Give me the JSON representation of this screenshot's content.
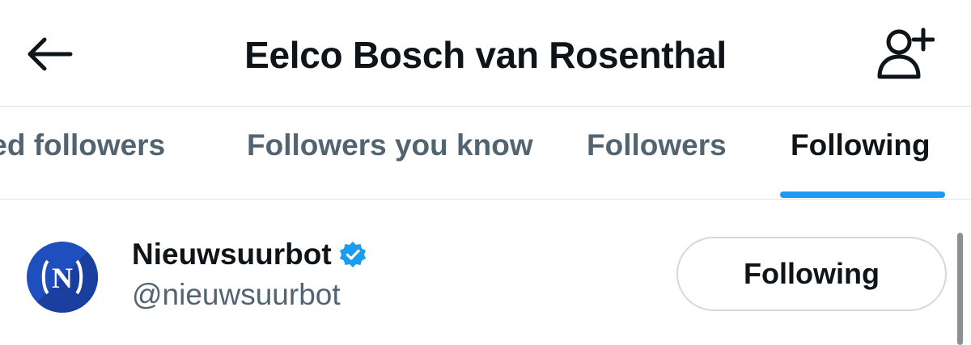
{
  "header": {
    "title": "Eelco Bosch van Rosenthal",
    "back_icon": "arrow-left-icon",
    "add_user_icon": "person-plus-icon"
  },
  "tabs": [
    {
      "label": "ied followers",
      "active": false
    },
    {
      "label": "Followers you know",
      "active": false
    },
    {
      "label": "Followers",
      "active": false
    },
    {
      "label": "Following",
      "active": true
    }
  ],
  "users": [
    {
      "display_name": "Nieuwsuurbot",
      "handle": "@nieuwsuurbot",
      "verified": true,
      "avatar_text": "N",
      "button_label": "Following"
    }
  ],
  "colors": {
    "accent": "#1d9bf0",
    "text_primary": "#0f1419",
    "text_secondary": "#536471",
    "border": "#cfd9de",
    "avatar_bg": "#1f4fbf"
  }
}
